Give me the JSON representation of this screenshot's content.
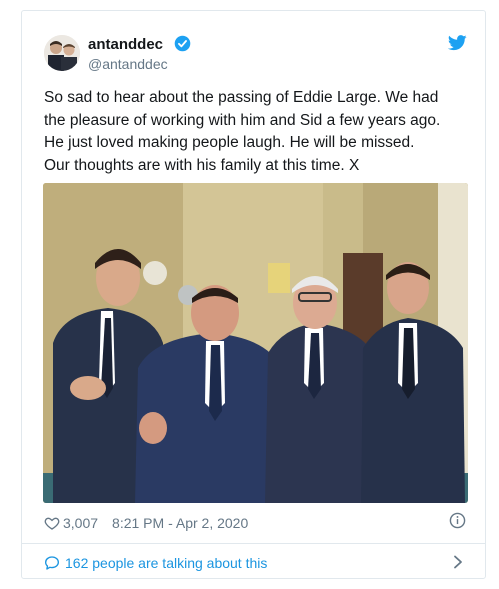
{
  "tweet": {
    "display_name": "antanddec",
    "handle": "@antanddec",
    "verified_icon": "verified-badge-icon",
    "text": "So sad to hear about the passing of Eddie Large. We had\nthe pleasure of working with him and Sid a few years ago.\nHe just loved making people laugh. He will be missed.\nOur thoughts are with his family at this time. X",
    "likes": "3,007",
    "timestamp": "8:21 PM - Apr 2, 2020",
    "talking_text": "162 people are talking about this"
  },
  "icons": {
    "brand": "twitter-bird-icon",
    "like": "heart-icon",
    "info": "info-icon",
    "conversation": "speech-bubble-icon",
    "chevron": "chevron-right-icon"
  },
  "colors": {
    "accent": "#1b95e0",
    "verified": "#1da1f2",
    "secondary_text": "#657786",
    "border": "#e1e8ed"
  }
}
